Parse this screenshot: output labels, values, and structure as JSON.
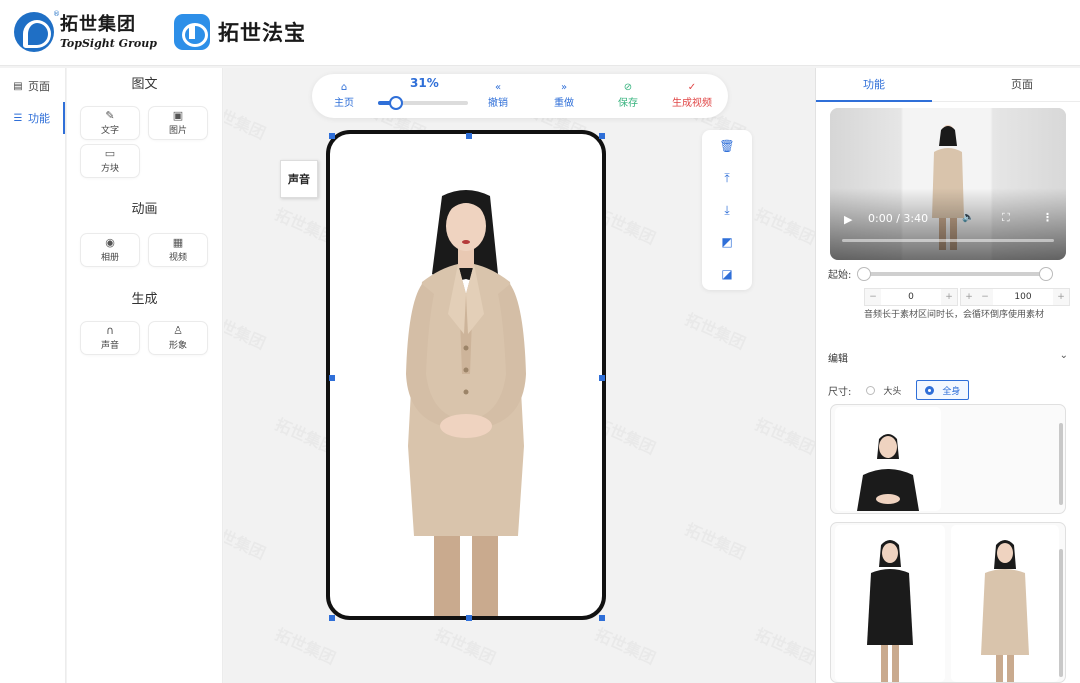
{
  "header": {
    "group_name": "拓世集团",
    "group_name_en": "TopSight Group",
    "app_name": "拓世法宝"
  },
  "left_nav": {
    "items": [
      {
        "label": "页面",
        "icon": "page-icon"
      },
      {
        "label": "功能",
        "icon": "sliders-icon"
      }
    ]
  },
  "tool_panel": {
    "sections": [
      {
        "title": "图文",
        "tools": [
          {
            "label": "文字",
            "icon": "edit-text-icon"
          },
          {
            "label": "图片",
            "icon": "image-icon"
          },
          {
            "label": "方块",
            "icon": "block-icon"
          }
        ]
      },
      {
        "title": "动画",
        "tools": [
          {
            "label": "相册",
            "icon": "camera-icon"
          },
          {
            "label": "视频",
            "icon": "film-icon"
          }
        ]
      },
      {
        "title": "生成",
        "tools": [
          {
            "label": "声音",
            "icon": "headphones-icon"
          },
          {
            "label": "形象",
            "icon": "person-icon"
          }
        ]
      }
    ]
  },
  "toolbar": {
    "home_label": "主页",
    "zoom_label": "31%",
    "zoom_value": 0.2,
    "undo_label": "撤销",
    "redo_label": "重做",
    "save_label": "保存",
    "generate_label": "生成视频",
    "colors": {
      "primary": "#2f6fd8",
      "save": "#36b37e",
      "generate": "#e04646"
    }
  },
  "canvas": {
    "sound_chip": "声音"
  },
  "layer_tools": [
    "trash-icon",
    "bring-up-icon",
    "send-down-icon",
    "bring-front-icon",
    "send-back-icon"
  ],
  "right_panel": {
    "tabs": [
      {
        "label": "功能",
        "active": true
      },
      {
        "label": "页面",
        "active": false
      }
    ],
    "video": {
      "time": "0:00 / 3:40"
    },
    "range": {
      "label": "起始:",
      "start": "0",
      "end": "100",
      "start_fraction": 0.0,
      "end_fraction": 1.0
    },
    "hint": "音频长于素材区间时长，会循环倒序使用素材",
    "edit_label": "编辑",
    "size": {
      "label": "尺寸:",
      "options": [
        {
          "label": "大头",
          "selected": false
        },
        {
          "label": "全身",
          "selected": true
        }
      ]
    }
  }
}
